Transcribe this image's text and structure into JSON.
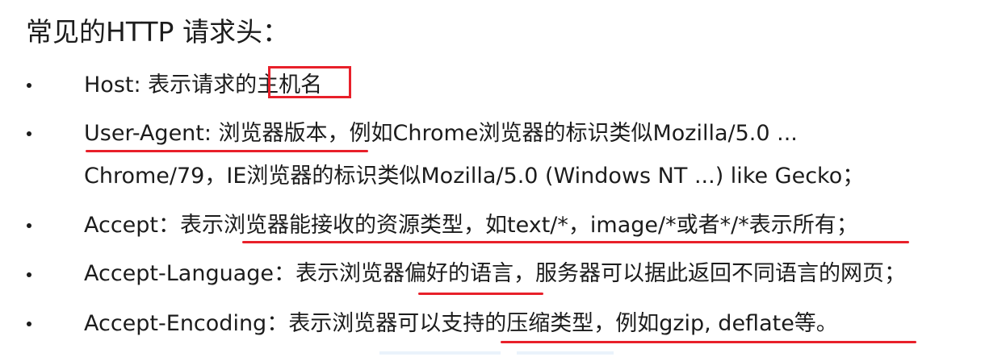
{
  "title": "常见的HTTP 请求头：",
  "items": [
    {
      "lines": [
        "Host: 表示请求的主机名"
      ]
    },
    {
      "lines": [
        "User-Agent: 浏览器版本，例如Chrome浏览器的标识类似Mozilla/5.0 ...",
        "Chrome/79，IE浏览器的标识类似Mozilla/5.0 (Windows NT ...) like Gecko；"
      ]
    },
    {
      "lines": [
        "Accept：表示浏览器能接收的资源类型，如text/*，image/*或者*/*表示所有；"
      ]
    },
    {
      "lines": [
        "Accept-Language：表示浏览器偏好的语言，服务器可以据此返回不同语言的网页；"
      ]
    },
    {
      "lines": [
        "Accept-Encoding：表示浏览器可以支持的压缩类型，例如gzip, deflate等。"
      ]
    }
  ],
  "colors": {
    "text": "#1c1c1c",
    "annotation": "#e8202a",
    "background": "#ffffff"
  }
}
